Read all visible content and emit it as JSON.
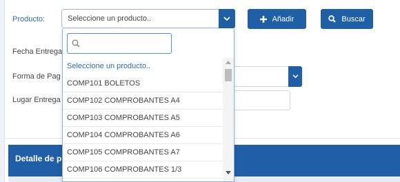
{
  "form": {
    "producto_label": "Producto:",
    "producto_selected": "Seleccione un producto..",
    "fecha_label": "Fecha Entrega",
    "forma_label": "Forma de Pag",
    "lugar_label": "Lugar Entrega"
  },
  "buttons": {
    "anadir": "Añadir",
    "buscar": "Buscar"
  },
  "dropdown": {
    "search_placeholder": "",
    "options": [
      "Seleccione un producto..",
      "COMP101 BOLETOS",
      "COMP102 COMPROBANTES A4",
      "COMP103 COMPROBANTES A5",
      "COMP104 COMPROBANTES A6",
      "COMP105 COMPROBANTES A7",
      "COMP106 COMPROBANTES 1/3"
    ]
  },
  "detail": {
    "title": "Detalle de p"
  },
  "colors": {
    "primary": "#1f5fa6",
    "link": "#2a6bb5"
  },
  "icons": [
    "chevron-down-icon",
    "plus-icon",
    "search-icon",
    "scroll-up-arrow-icon",
    "scroll-down-arrow-icon"
  ]
}
